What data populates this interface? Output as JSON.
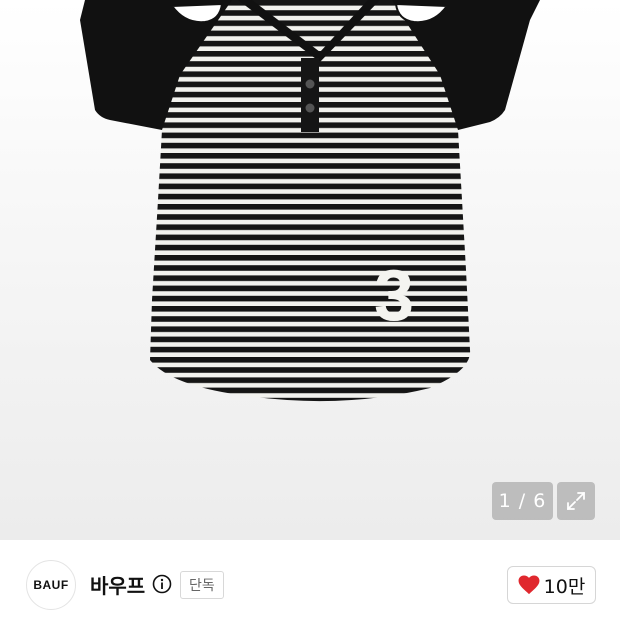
{
  "product_image": {
    "counter": "1 / 6",
    "graphic_number": "3"
  },
  "brand": {
    "logo_text": "BAUF",
    "name": "바우프",
    "badge": "단독"
  },
  "like": {
    "count": "10만",
    "icon": "heart-icon",
    "color": "#e0282e"
  },
  "icons": {
    "expand": "expand-icon",
    "info": "info-icon"
  }
}
